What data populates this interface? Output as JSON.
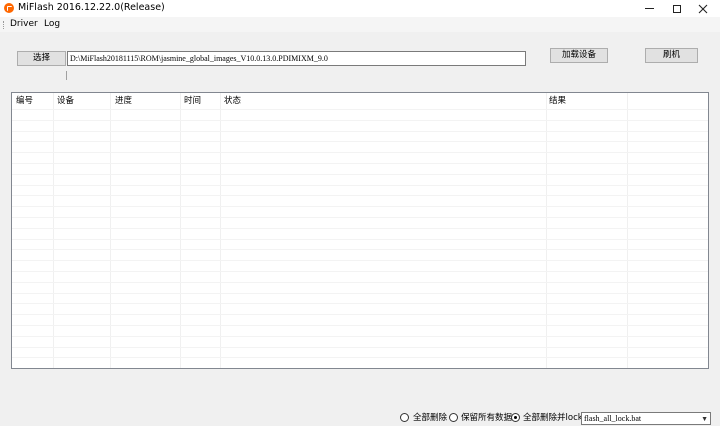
{
  "window": {
    "title": "MiFlash 2016.12.22.0(Release)"
  },
  "menu": {
    "items": [
      "Driver",
      "Log"
    ]
  },
  "toolbar": {
    "select_label": "选择",
    "path_value": "D:\\MiFlash20181115\\ROM\\jasmine_global_images_V10.0.13.0.PDIMIXM_9.0",
    "load_device_label": "加载设备",
    "flash_label": "刷机"
  },
  "list": {
    "columns": [
      "编号",
      "设备",
      "进度",
      "时间",
      "状态",
      "结果"
    ]
  },
  "status": {
    "options": [
      "全部删除",
      "保留所有数据",
      "全部删除并lock"
    ],
    "selected_option": "全部删除并lock",
    "script_value": "flash_all_lock.bat"
  }
}
